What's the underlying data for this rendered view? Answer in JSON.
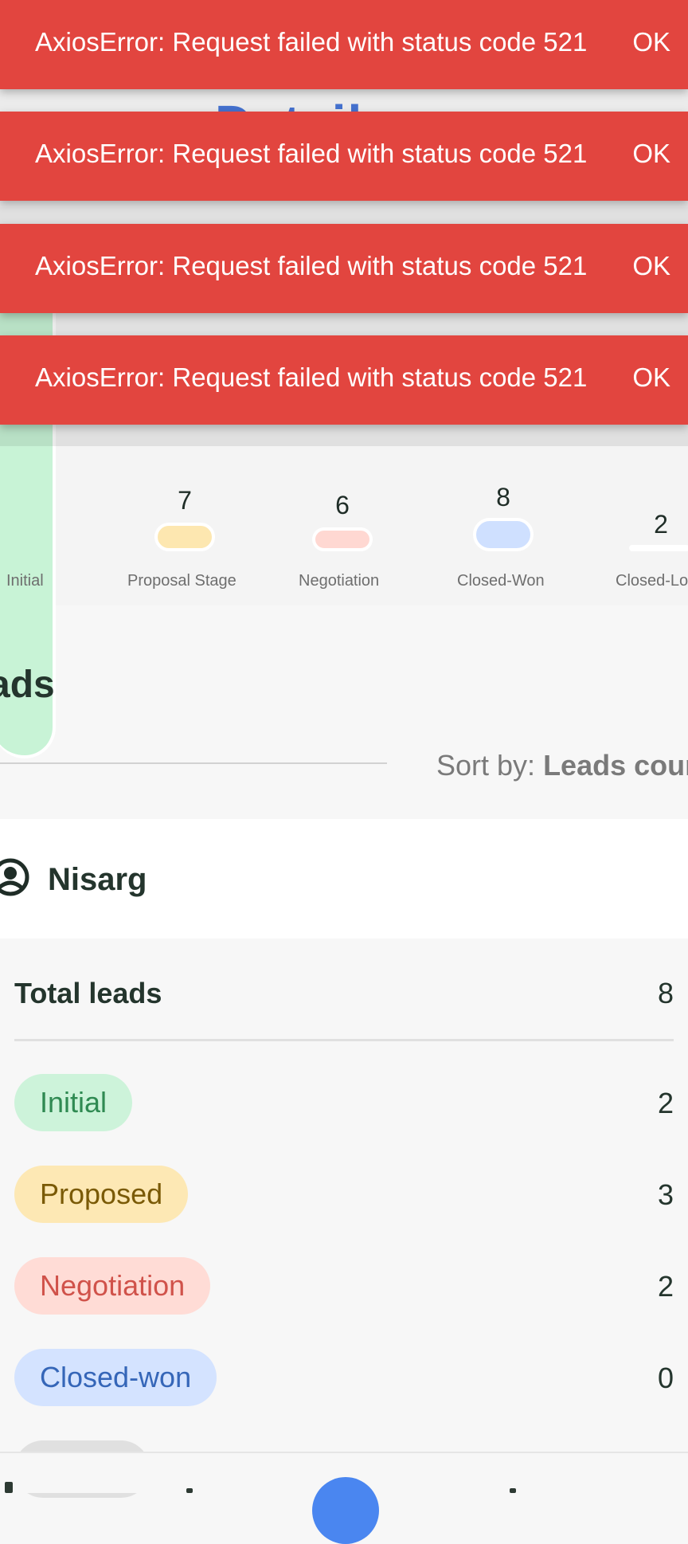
{
  "page_title_fragment": "Detail",
  "chart": {
    "stages": [
      {
        "label": "Initial",
        "value": ""
      },
      {
        "label": "Proposal Stage",
        "value": "7"
      },
      {
        "label": "Negotiation",
        "value": "6"
      },
      {
        "label": "Closed-Won",
        "value": "8"
      },
      {
        "label": "Closed-Lo",
        "value": "2"
      }
    ]
  },
  "leads_section": {
    "title": "ads",
    "sort_label": "Sort by: ",
    "sort_value": "Leads coun"
  },
  "lead_card": {
    "user_name": "Nisarg",
    "total_label": "Total leads",
    "total_value": "8",
    "stages": [
      {
        "label": "Initial",
        "count": "2",
        "bg": "#cdf3da",
        "fg": "#2f8a52"
      },
      {
        "label": "Proposed",
        "count": "3",
        "bg": "#fde8b4",
        "fg": "#7a5a06"
      },
      {
        "label": "Negotiation",
        "count": "2",
        "bg": "#ffdcd6",
        "fg": "#d0524a"
      },
      {
        "label": "Closed-won",
        "count": "0",
        "bg": "#d4e3ff",
        "fg": "#3566b8"
      }
    ]
  },
  "snackbars": [
    {
      "message": "AxiosError: Request failed with status code 521",
      "action": "OK"
    },
    {
      "message": "AxiosError: Request failed with status code 521",
      "action": "OK"
    },
    {
      "message": "AxiosError: Request failed with status code 521",
      "action": "OK"
    },
    {
      "message": "AxiosError: Request failed with status code 521",
      "action": "OK"
    }
  ],
  "colors": {
    "snackbar": "#e2453f",
    "accent": "#4a86f0"
  }
}
